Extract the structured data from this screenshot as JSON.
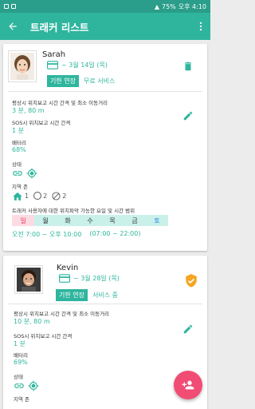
{
  "status_bar": {
    "battery": "75%",
    "time": "오후 4:10"
  },
  "app_bar": {
    "title": "트래커 리스트"
  },
  "trackers": [
    {
      "name": "Sarah",
      "period": "~ 3월 14일 (목)",
      "extend_label": "기한 연장",
      "service_status": "무료 서비스",
      "report_label": "평상시 위치보고 시간 간격 및 최소 이동거리",
      "report_value": "3 분, 80 m",
      "sos_label": "SOS시 위치보고 시간 간격",
      "sos_value": "1 분",
      "battery_label": "배터리",
      "battery_value": "68%",
      "status_label": "상태",
      "zone_label": "지역 존",
      "zones": {
        "home": "1",
        "circle": "2",
        "slash": "2"
      },
      "schedule_label": "트래커 사용자에 대한 위치파악 가능한 요일 및 시간 범위",
      "days": [
        "일",
        "월",
        "화",
        "수",
        "목",
        "금",
        "토"
      ],
      "time_local": "오전 7:00 ~ 오후 10:00",
      "time_24h": "(07:00 ~ 22:00)"
    },
    {
      "name": "Kevin",
      "period": "~ 3월 28일 (목)",
      "extend_label": "기한 연장",
      "service_status": "서비스 중",
      "report_label": "평상시 위치보고 시간 간격 및 최소 이동거리",
      "report_value": "10 분, 80 m",
      "sos_label": "SOS시 위치보고 시간 간격",
      "sos_value": "1 분",
      "battery_label": "배터리",
      "battery_value": "69%",
      "status_label": "상태",
      "zone_label": "지역 존"
    }
  ],
  "colors": {
    "primary": "#2fb59e",
    "statusbar": "#2a9e8a",
    "fab": "#f14d74",
    "shield": "#f5a623",
    "sunday": "#e53a5c",
    "saturday": "#1a7ee8"
  },
  "icons": [
    "back-arrow-icon",
    "more-vert-icon",
    "card-icon",
    "delete-icon",
    "edit-icon",
    "shield-check-icon",
    "link-icon",
    "gps-target-icon",
    "home-icon",
    "add-person-icon"
  ]
}
